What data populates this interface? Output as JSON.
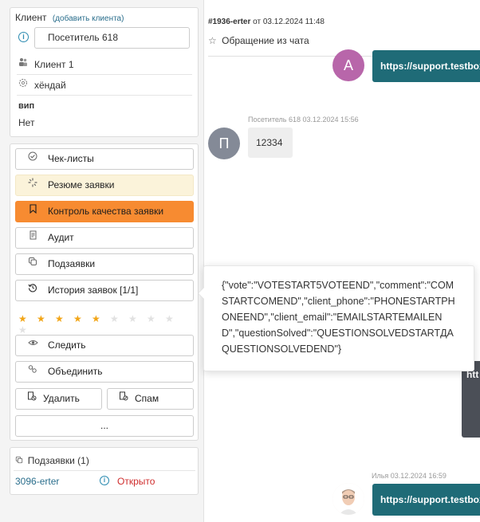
{
  "client": {
    "heading": "Клиент",
    "add_link": "(добавить клиента)",
    "visitor_value": "Посетитель 618",
    "client_name": "Клиент 1",
    "car": "хёндай",
    "vip_label": "вип",
    "vip_value": "Нет"
  },
  "actions": {
    "checklists": "Чек-листы",
    "resume": "Резюме заявки",
    "quality": "Контроль качества заявки",
    "audit": "Аудит",
    "subrequests": "Подзаявки",
    "history": "История заявок [1/1]",
    "rating": {
      "value": 5,
      "max": 10
    },
    "follow": "Следить",
    "merge": "Объединить",
    "delete": "Удалить",
    "spam": "Спам",
    "more": "..."
  },
  "subrequests": {
    "heading": "Подзаявки (1)",
    "item_id": "3096-erter",
    "item_status": "Открыто",
    "status_color": "#cf2d2d"
  },
  "ticket": {
    "id": "#1936-erter",
    "date_prefix": "от 03.12.2024 11:48",
    "title": "Обращение из чата"
  },
  "chat": {
    "avatar_a": "А",
    "avatar_p": "П",
    "link_text_1": "https://support.testbox",
    "visitor_meta": "Посетитель 618 03.12.2024 15:56",
    "visitor_message": "12334",
    "dark_block_text": "htt",
    "agent_meta": "Илья 03.12.2024 16:59",
    "link_text_2": "https://support.testbox"
  },
  "tooltip": {
    "text": "{\"vote\":\"VOTESTART5VOTEEND\",\"comment\":\"COMSTARTCOMEND\",\"client_phone\":\"PHONESTARTPHONEEND\",\"client_email\":\"EMAILSTARTEMAILEND\",\"questionSolved\":\"QUESTIONSOLVEDSTARTДAQUESTIONSOLVEDEND\"}"
  },
  "colors": {
    "accent_orange": "#f78b31",
    "resume_bg": "#fbf3da",
    "link_teal": "#1f6b77",
    "star": "#f2a516",
    "avatar_a": "#b866aa",
    "avatar_p": "#848a97"
  }
}
